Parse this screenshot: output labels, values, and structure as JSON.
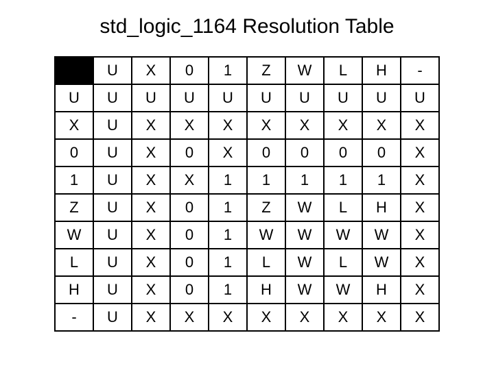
{
  "title": "std_logic_1164 Resolution Table",
  "col_headers": [
    "U",
    "X",
    "0",
    "1",
    "Z",
    "W",
    "L",
    "H",
    "-"
  ],
  "row_headers": [
    "U",
    "X",
    "0",
    "1",
    "Z",
    "W",
    "L",
    "H",
    "-"
  ],
  "chart_data": {
    "type": "table",
    "title": "std_logic_1164 Resolution Table",
    "columns": [
      "U",
      "X",
      "0",
      "1",
      "Z",
      "W",
      "L",
      "H",
      "-"
    ],
    "rows": [
      "U",
      "X",
      "0",
      "1",
      "Z",
      "W",
      "L",
      "H",
      "-"
    ],
    "values": [
      [
        "U",
        "U",
        "U",
        "U",
        "U",
        "U",
        "U",
        "U",
        "U"
      ],
      [
        "U",
        "X",
        "X",
        "X",
        "X",
        "X",
        "X",
        "X",
        "X"
      ],
      [
        "U",
        "X",
        "0",
        "X",
        "0",
        "0",
        "0",
        "0",
        "X"
      ],
      [
        "U",
        "X",
        "X",
        "1",
        "1",
        "1",
        "1",
        "1",
        "X"
      ],
      [
        "U",
        "X",
        "0",
        "1",
        "Z",
        "W",
        "L",
        "H",
        "X"
      ],
      [
        "U",
        "X",
        "0",
        "1",
        "W",
        "W",
        "W",
        "W",
        "X"
      ],
      [
        "U",
        "X",
        "0",
        "1",
        "L",
        "W",
        "L",
        "W",
        "X"
      ],
      [
        "U",
        "X",
        "0",
        "1",
        "H",
        "W",
        "W",
        "H",
        "X"
      ],
      [
        "U",
        "X",
        "X",
        "X",
        "X",
        "X",
        "X",
        "X",
        "X"
      ]
    ]
  }
}
